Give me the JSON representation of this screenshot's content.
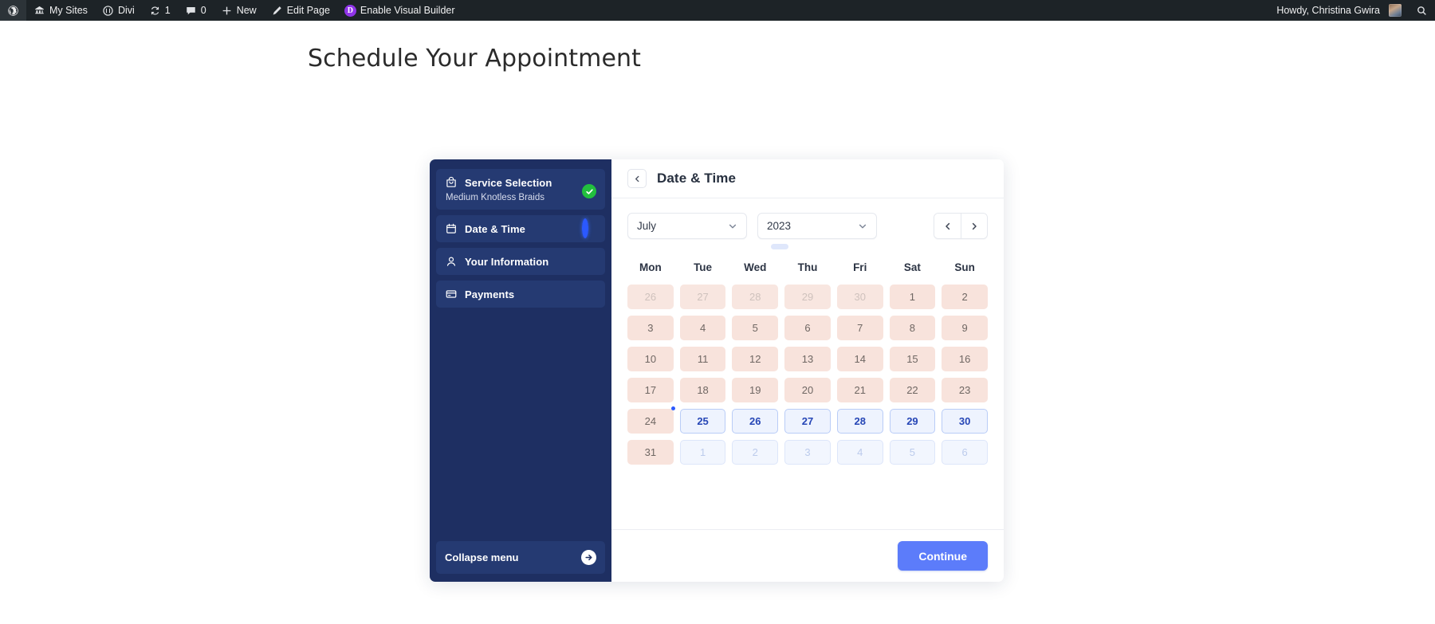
{
  "adminbar": {
    "left_items": [
      {
        "icon": "wordpress-logo-icon",
        "label": ""
      },
      {
        "icon": "my-sites-icon",
        "label": "My Sites"
      },
      {
        "icon": "divi-icon",
        "label": "Divi"
      },
      {
        "icon": "updates-icon",
        "label": "1"
      },
      {
        "icon": "comments-icon",
        "label": "0"
      },
      {
        "icon": "plus-icon",
        "label": "New"
      },
      {
        "icon": "pencil-icon",
        "label": "Edit Page"
      },
      {
        "icon": "divi-badge-icon",
        "label": "Enable Visual Builder"
      }
    ],
    "divi_badge_letter": "D",
    "howdy": "Howdy, Christina Gwira",
    "search_icon": "search-icon"
  },
  "page": {
    "title": "Schedule Your Appointment"
  },
  "booking": {
    "sidebar": {
      "steps": [
        {
          "icon": "service-bag-icon",
          "label": "Service Selection",
          "sub": "Medium Knotless Braids",
          "status": "done"
        },
        {
          "icon": "calendar-icon",
          "label": "Date & Time",
          "sub": "",
          "status": "active"
        },
        {
          "icon": "person-icon",
          "label": "Your Information",
          "sub": "",
          "status": "idle"
        },
        {
          "icon": "credit-card-icon",
          "label": "Payments",
          "sub": "",
          "status": "idle"
        }
      ],
      "collapse_label": "Collapse menu",
      "collapse_icon": "arrow-right-circle-icon"
    },
    "main": {
      "back_icon": "chevron-left-icon",
      "title": "Date & Time",
      "month_value": "July",
      "year_value": "2023",
      "month_chevron_icon": "chevron-down-icon",
      "year_chevron_icon": "chevron-down-icon",
      "prev_icon": "chevron-left-icon",
      "next_icon": "chevron-right-icon",
      "weekdays": [
        "Mon",
        "Tue",
        "Wed",
        "Thu",
        "Fri",
        "Sat",
        "Sun"
      ],
      "days": [
        {
          "n": "26",
          "state": "off"
        },
        {
          "n": "27",
          "state": "off"
        },
        {
          "n": "28",
          "state": "off"
        },
        {
          "n": "29",
          "state": "off"
        },
        {
          "n": "30",
          "state": "off"
        },
        {
          "n": "1",
          "state": "blocked"
        },
        {
          "n": "2",
          "state": "blocked"
        },
        {
          "n": "3",
          "state": "blocked"
        },
        {
          "n": "4",
          "state": "blocked"
        },
        {
          "n": "5",
          "state": "blocked"
        },
        {
          "n": "6",
          "state": "blocked"
        },
        {
          "n": "7",
          "state": "blocked"
        },
        {
          "n": "8",
          "state": "blocked"
        },
        {
          "n": "9",
          "state": "blocked"
        },
        {
          "n": "10",
          "state": "blocked"
        },
        {
          "n": "11",
          "state": "blocked"
        },
        {
          "n": "12",
          "state": "blocked"
        },
        {
          "n": "13",
          "state": "blocked"
        },
        {
          "n": "14",
          "state": "blocked"
        },
        {
          "n": "15",
          "state": "blocked"
        },
        {
          "n": "16",
          "state": "blocked"
        },
        {
          "n": "17",
          "state": "blocked"
        },
        {
          "n": "18",
          "state": "blocked"
        },
        {
          "n": "19",
          "state": "blocked"
        },
        {
          "n": "20",
          "state": "blocked"
        },
        {
          "n": "21",
          "state": "blocked"
        },
        {
          "n": "22",
          "state": "blocked"
        },
        {
          "n": "23",
          "state": "blocked"
        },
        {
          "n": "24",
          "state": "blocked",
          "today": true
        },
        {
          "n": "25",
          "state": "avail"
        },
        {
          "n": "26",
          "state": "avail"
        },
        {
          "n": "27",
          "state": "avail"
        },
        {
          "n": "28",
          "state": "avail"
        },
        {
          "n": "29",
          "state": "avail"
        },
        {
          "n": "30",
          "state": "avail"
        },
        {
          "n": "31",
          "state": "blocked"
        },
        {
          "n": "1",
          "state": "nextoff"
        },
        {
          "n": "2",
          "state": "nextoff"
        },
        {
          "n": "3",
          "state": "nextoff"
        },
        {
          "n": "4",
          "state": "nextoff"
        },
        {
          "n": "5",
          "state": "nextoff"
        },
        {
          "n": "6",
          "state": "nextoff"
        }
      ],
      "continue_label": "Continue"
    }
  },
  "colors": {
    "adminbar_bg": "#1d2327",
    "sidebar_bg": "#1e2f62",
    "accent_blue": "#5c7cfa",
    "done_green": "#22c03e",
    "active_blue": "#2b59ff",
    "blocked_pink": "#f8e3dc",
    "avail_blue_bg": "#eef3fe"
  }
}
